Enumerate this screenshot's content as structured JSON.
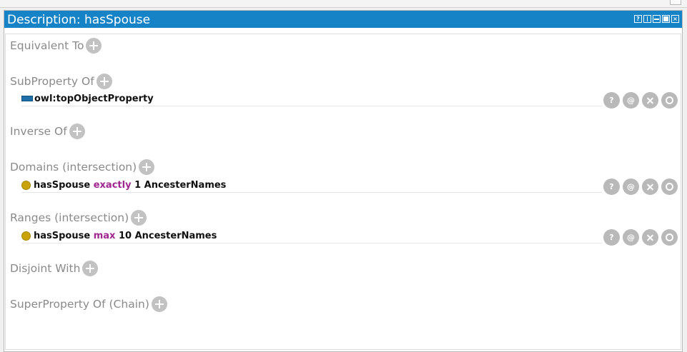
{
  "panel": {
    "title": "Description: hasSpouse",
    "titlebar_icons": [
      "help-icon",
      "split-view-icon",
      "minimize-icon",
      "maximize-icon",
      "close-icon"
    ]
  },
  "sections": {
    "equivalent_to": "Equivalent To",
    "subproperty_of": "SubProperty Of",
    "inverse_of": "Inverse Of",
    "domains": "Domains (intersection)",
    "ranges": "Ranges (intersection)",
    "disjoint_with": "Disjoint With",
    "superproperty_of_chain": "SuperProperty Of (Chain)"
  },
  "entries": {
    "subproperty": {
      "name": "owl:topObjectProperty"
    },
    "domain": {
      "property": "hasSpouse",
      "keyword": "exactly",
      "rest": "1 AncesterNames"
    },
    "range": {
      "property": "hasSpouse",
      "keyword": "max",
      "rest": "10 AncesterNames"
    }
  },
  "action_icons": {
    "help": "?",
    "annotate": "@"
  },
  "colors": {
    "titlebar": "#1583c6",
    "keyword": "#a0278f",
    "class_dot": "#c9a30b",
    "property_swatch": "#1e6fa8",
    "section_label": "#8a8a8a",
    "button_gray": "#b9b9b9"
  }
}
